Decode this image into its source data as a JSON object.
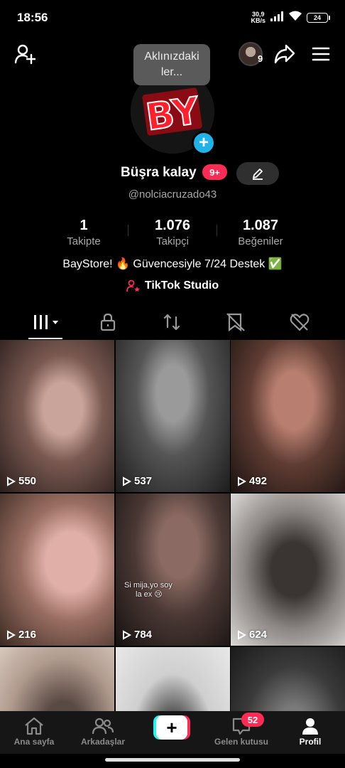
{
  "status_bar": {
    "time": "18:56",
    "net_speed_value": "30,9",
    "net_speed_unit": "KB/s",
    "battery": "24"
  },
  "top_bar": {
    "story_count": "9"
  },
  "tooltip": {
    "line1": "Aklınızdaki",
    "line2": "ler..."
  },
  "profile": {
    "logo_text": "BY",
    "display_name": "Büşra kalay",
    "notif_badge": "9+",
    "username": "@nolciacruzado43",
    "stats": [
      {
        "value": "1",
        "label": "Takipte"
      },
      {
        "value": "1.076",
        "label": "Takipçi"
      },
      {
        "value": "1.087",
        "label": "Beğeniler"
      }
    ],
    "bio": "BayStore! 🔥 Güvencesiyle 7/24 Destek ✅",
    "studio_link": "TikTok Studio"
  },
  "videos": [
    {
      "views": "550"
    },
    {
      "views": "537"
    },
    {
      "views": "492"
    },
    {
      "views": "216"
    },
    {
      "views": "784",
      "caption_line1": "Si mija,yo soy",
      "caption_line2": "la ex 😢"
    },
    {
      "views": "624"
    }
  ],
  "bottom_nav": {
    "home": "Ana sayfa",
    "friends": "Arkadaşlar",
    "inbox": "Gelen kutusu",
    "inbox_badge": "52",
    "profile": "Profil"
  },
  "colors": {
    "accent_red": "#fe2c55",
    "accent_cyan": "#25f4ee",
    "add_blue": "#1fb4e8",
    "background": "#000000"
  }
}
